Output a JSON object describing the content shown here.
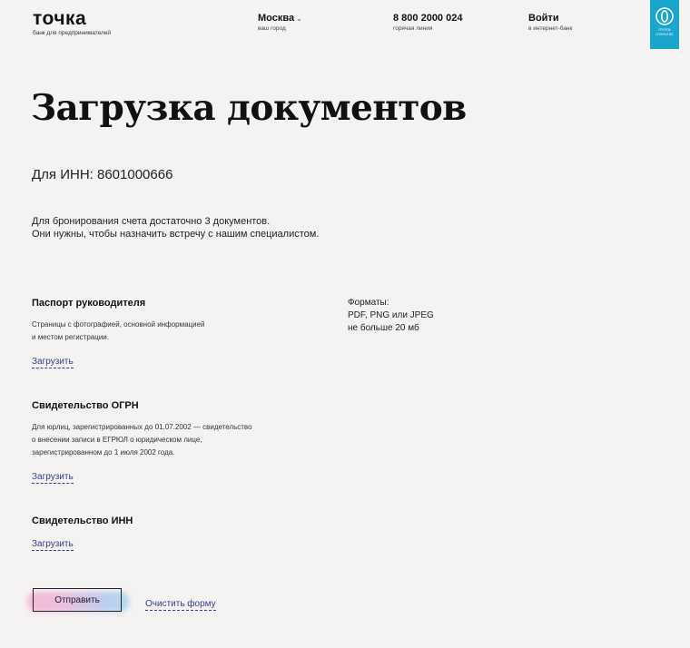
{
  "header": {
    "logo_name": "точка",
    "logo_sub": "банк для предпринимателей",
    "city": "Москва",
    "city_sub": "ваш город",
    "phone": "8 800 2000 024",
    "phone_sub": "горячая линия",
    "login": "Войти",
    "login_sub": "в интернет-банк",
    "badge_line1": "ГРУППА",
    "badge_line2": "ОТКРЫТИЕ",
    "badge_color": "#1aa5cf"
  },
  "page": {
    "title": "Загрузка документов",
    "inn": "Для ИНН: 8601000666",
    "intro_line1": "Для бронирования счета достаточно 3 документов.",
    "intro_line2": "Они нужны, чтобы назначить встречу с нашим специалистом."
  },
  "formats": {
    "label": "Форматы:",
    "types": "PDF, PNG или JPEG",
    "size": "не больше 20 мб"
  },
  "documents": [
    {
      "title": "Паспорт руководителя",
      "desc_lines": [
        "Страницы с фотографией, основной информацией",
        "и местом регистрации."
      ],
      "upload": "Загрузить"
    },
    {
      "title": "Свидетельство ОГРН",
      "desc_lines": [
        "Для юрлиц, зарегистрированных до 01.07.2002 — свидетельство",
        "о внесении записи в ЕГРЮЛ о юридическом лице,",
        "зарегистрированном до 1 июля 2002 года."
      ],
      "upload": "Загрузить"
    },
    {
      "title": "Свидетельство ИНН",
      "upload": "Загрузить"
    }
  ],
  "actions": {
    "submit": "Отправить",
    "clear": "Очистить форму",
    "link_color": "#35408b"
  }
}
